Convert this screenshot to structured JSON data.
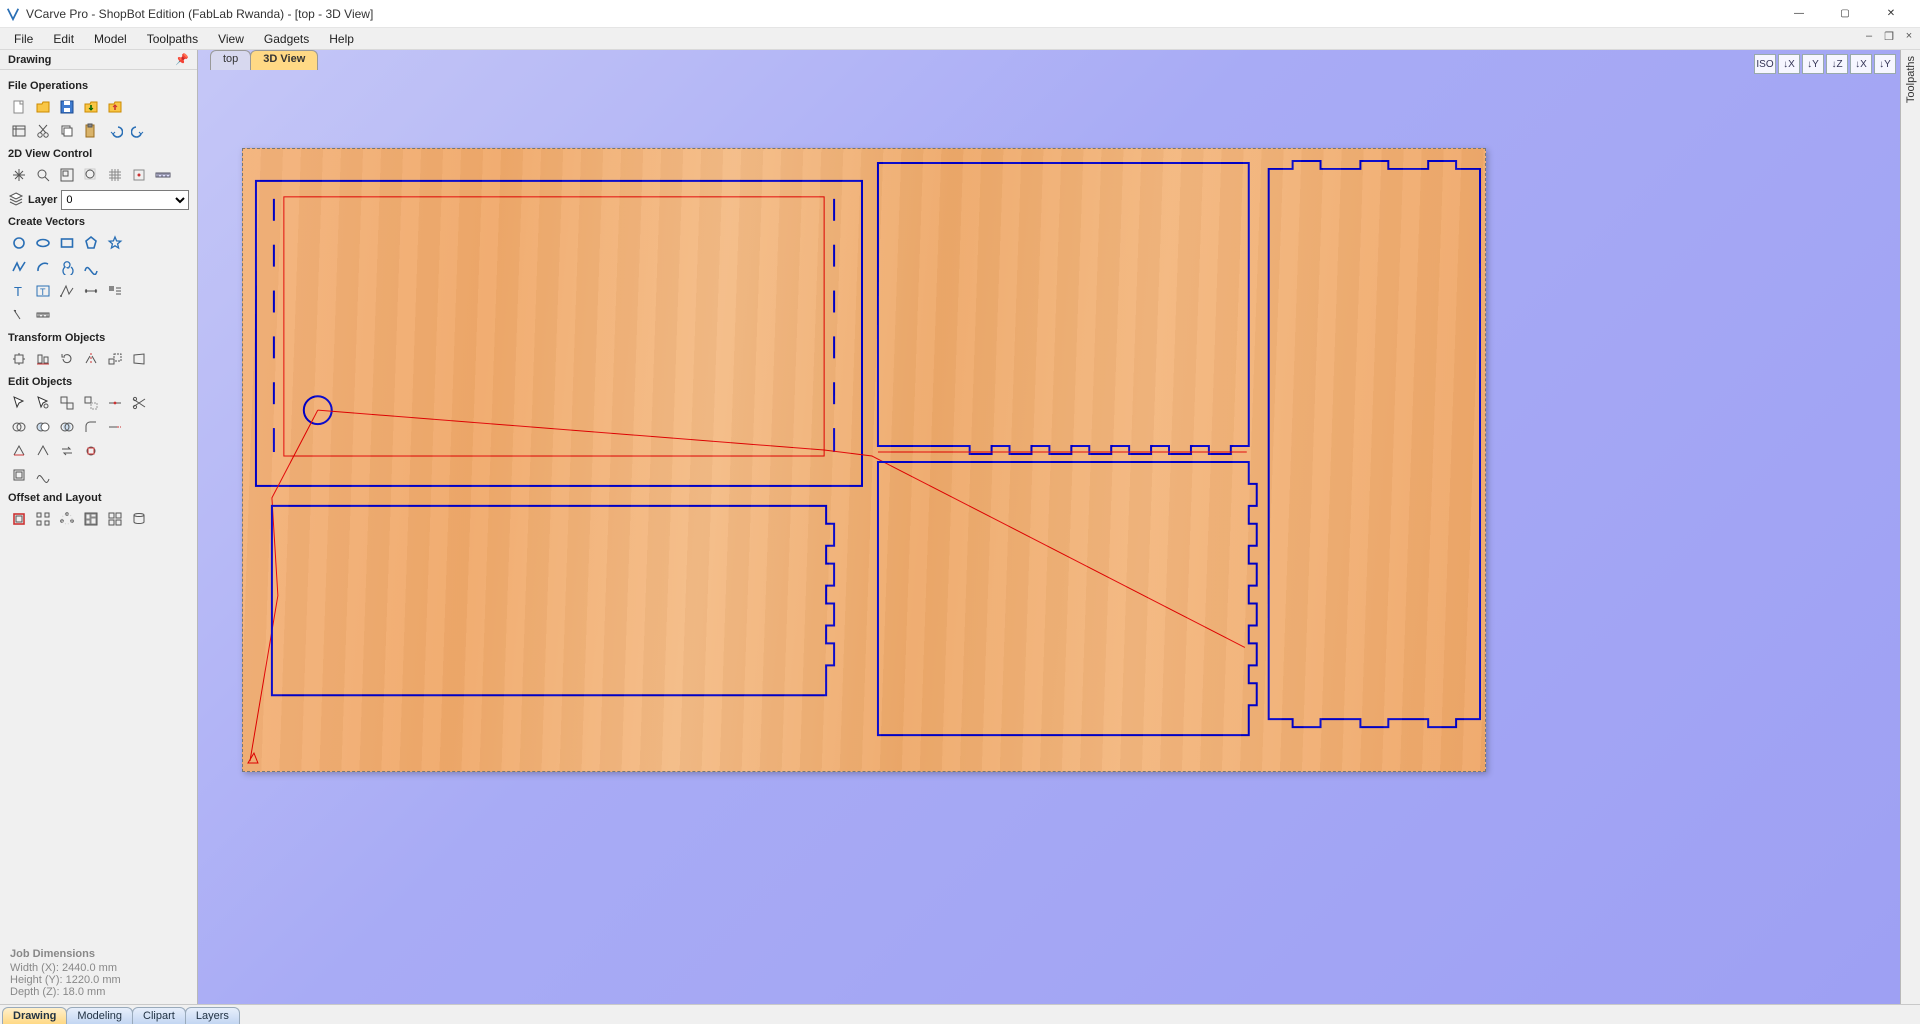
{
  "window": {
    "title": "VCarve Pro - ShopBot Edition (FabLab Rwanda) - [top - 3D View]"
  },
  "menu": {
    "items": [
      "File",
      "Edit",
      "Model",
      "Toolpaths",
      "View",
      "Gadgets",
      "Help"
    ]
  },
  "mdi": {
    "min": "–",
    "restore": "❐",
    "close": "×"
  },
  "left_panel": {
    "title": "Drawing",
    "sections": {
      "file_ops": "File Operations",
      "view_ctrl": "2D View Control",
      "layer_label": "Layer",
      "layer_value": "0",
      "create_vec": "Create Vectors",
      "transform": "Transform Objects",
      "edit_obj": "Edit Objects",
      "offset": "Offset and Layout"
    }
  },
  "job_dims": {
    "title": "Job Dimensions",
    "width": "Width  (X): 2440.0 mm",
    "height": "Height (Y): 1220.0 mm",
    "depth": "Depth  (Z): 18.0 mm"
  },
  "view_tabs": {
    "top": "top",
    "three_d": "3D View"
  },
  "view_toolbar": [
    "ISO",
    "↓X",
    "↓Y",
    "↓Z",
    "↓X",
    "↓Y"
  ],
  "right_strip": {
    "label": "Toolpaths"
  },
  "bottom_tabs": [
    "Drawing",
    "Modeling",
    "Clipart",
    "Layers"
  ],
  "colors": {
    "vector_blue": "#0000c8",
    "toolpath_red": "#e00000",
    "wood": "#f0a96a"
  }
}
